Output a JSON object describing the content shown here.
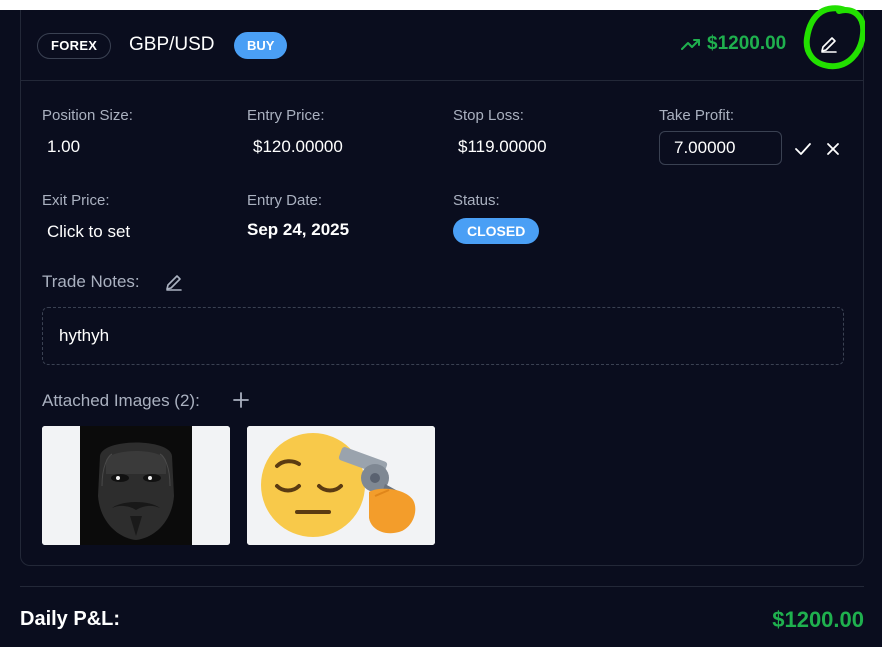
{
  "trade": {
    "market": "FOREX",
    "symbol": "GBP/USD",
    "side": "BUY",
    "pnl": "$1200.00",
    "colors": {
      "profit": "#1fb04e",
      "accent": "#4a9ff5",
      "background": "#0a0d1e",
      "highlight": "#22e000"
    }
  },
  "fields": {
    "position_size": {
      "label": "Position Size:",
      "value": "1.00"
    },
    "entry_price": {
      "label": "Entry Price:",
      "value": "$120.00000"
    },
    "stop_loss": {
      "label": "Stop Loss:",
      "value": "$119.00000"
    },
    "take_profit": {
      "label": "Take Profit:",
      "value": "7.00000"
    },
    "exit_price": {
      "label": "Exit Price:",
      "value": "Click to set"
    },
    "entry_date": {
      "label": "Entry Date:",
      "value": "Sep 24, 2025"
    },
    "status": {
      "label": "Status:",
      "value": "CLOSED"
    }
  },
  "notes": {
    "label": "Trade Notes:",
    "text": "hythyh"
  },
  "images": {
    "label": "Attached Images (2):",
    "items": [
      {
        "icon": "masked-face-image"
      },
      {
        "icon": "pensive-face-with-revolver-emoji"
      }
    ]
  },
  "daily": {
    "label": "Daily P&L:",
    "value": "$1200.00"
  },
  "icons": {
    "trend": "trending-up-icon",
    "edit": "pencil-icon",
    "confirm": "check-icon",
    "cancel": "close-icon",
    "add": "plus-icon"
  }
}
